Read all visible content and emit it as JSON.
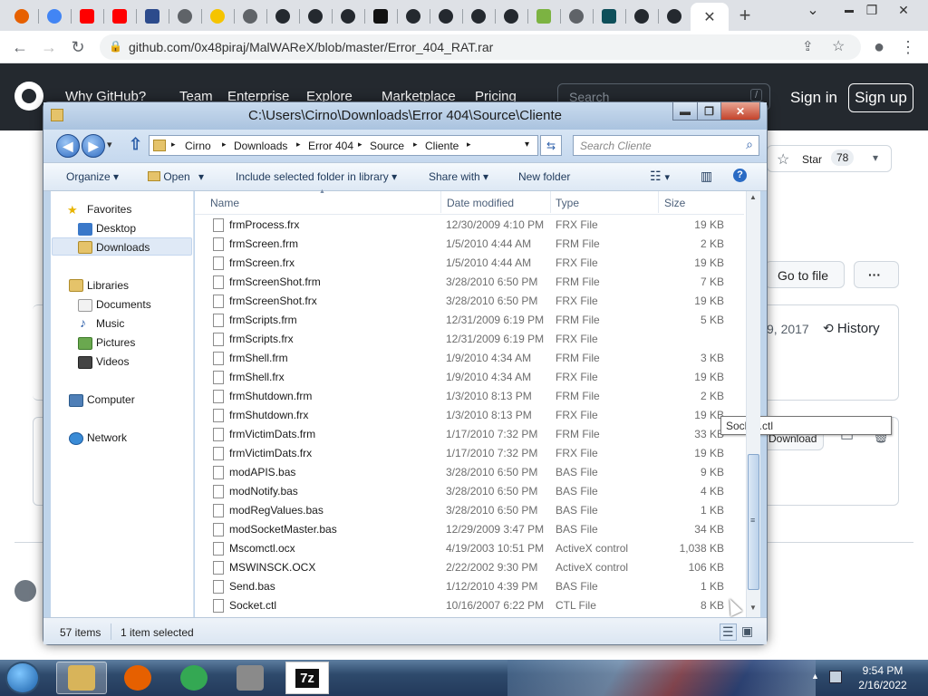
{
  "browser": {
    "url": "github.com/0x48piraj/MalWAReX/blob/master/Error_404_RAT.rar",
    "window_minimize": "▬",
    "window_restore": "❐",
    "window_close": "✕",
    "tab_close": "✕",
    "new_tab": "+",
    "tabs_dropdown": "⌄",
    "back_glyph": "←",
    "forward_glyph": "→",
    "reload_glyph": "↻",
    "lock_glyph": "🔒",
    "share_glyph": "⇪",
    "star_glyph": "☆",
    "profile_glyph": "●",
    "menu_glyph": "⋮",
    "tabs": [
      {
        "icon": "firefox-icon",
        "color": "#e66000"
      },
      {
        "icon": "google-icon",
        "color": "#4285f4"
      },
      {
        "icon": "youtube-icon",
        "color": "#ff0000"
      },
      {
        "icon": "youtube-icon",
        "color": "#ff0000"
      },
      {
        "icon": "site-icon",
        "color": "#2c4b8c"
      },
      {
        "icon": "globe-icon",
        "color": "#5f6368"
      },
      {
        "icon": "shell-icon",
        "color": "#f5c400"
      },
      {
        "icon": "globe-icon",
        "color": "#5f6368"
      },
      {
        "icon": "github-icon",
        "color": "#24292f"
      },
      {
        "icon": "github-icon",
        "color": "#24292f"
      },
      {
        "icon": "github-icon",
        "color": "#24292f"
      },
      {
        "icon": "site-icon",
        "color": "#111111"
      },
      {
        "icon": "github-icon",
        "color": "#24292f"
      },
      {
        "icon": "github-icon",
        "color": "#24292f"
      },
      {
        "icon": "github-icon",
        "color": "#24292f"
      },
      {
        "icon": "github-icon",
        "color": "#24292f"
      },
      {
        "icon": "android-icon",
        "color": "#7cb342"
      },
      {
        "icon": "globe-icon",
        "color": "#5f6368"
      },
      {
        "icon": "site-icon",
        "color": "#0e4f5a"
      },
      {
        "icon": "github-icon",
        "color": "#24292f"
      },
      {
        "icon": "github-icon",
        "color": "#24292f"
      }
    ]
  },
  "github": {
    "nav": [
      "Why GitHub?",
      "Team",
      "Enterprise",
      "Explore",
      "Marketplace",
      "Pricing"
    ],
    "search_placeholder": "Search",
    "search_key": "/",
    "signin": "Sign in",
    "signup": "Sign up",
    "star_label": "Star",
    "star_count": "78",
    "star_dropdown": "▾",
    "goto_file": "Go to file",
    "more": "···",
    "date_fragment": "9, 2017",
    "history": "History",
    "download": "Download"
  },
  "explorer": {
    "title": "C:\\Users\\Cirno\\Downloads\\Error 404\\Source\\Cliente",
    "titlebar_min": "▬",
    "titlebar_max": "❐",
    "titlebar_close": "✕",
    "back_glyph": "◀",
    "forward_glyph": "▶",
    "history_glyph": "▾",
    "up_glyph": "⇧",
    "crumb_sep": "▸",
    "address_dropdown": "▾",
    "refresh_glyph": "⇆",
    "search_glyph": "⌕",
    "breadcrumb": [
      "Cirno",
      "Downloads",
      "Error 404",
      "Source",
      "Cliente"
    ],
    "search_placeholder": "Search Cliente",
    "commands": {
      "organize": "Organize",
      "open": "Open",
      "include": "Include selected folder in library",
      "share": "Share with",
      "new_folder": "New folder"
    },
    "cmd_dropdown": "▾",
    "view_glyph": "☷",
    "preview_glyph": "▥",
    "help_glyph": "?",
    "nav": {
      "favorites": "Favorites",
      "desktop": "Desktop",
      "downloads": "Downloads",
      "libraries": "Libraries",
      "documents": "Documents",
      "music": "Music",
      "pictures": "Pictures",
      "videos": "Videos",
      "computer": "Computer",
      "network": "Network"
    },
    "nav_star_glyph": "★",
    "nav_note_glyph": "♪",
    "columns": {
      "name": "Name",
      "date": "Date modified",
      "type": "Type",
      "size": "Size"
    },
    "sort_glyph": "▲",
    "files": [
      {
        "name": "frmProcess.frx",
        "date": "12/30/2009 4:10 PM",
        "type": "FRX File",
        "size": "19 KB"
      },
      {
        "name": "frmScreen.frm",
        "date": "1/5/2010 4:44 AM",
        "type": "FRM File",
        "size": "2 KB"
      },
      {
        "name": "frmScreen.frx",
        "date": "1/5/2010 4:44 AM",
        "type": "FRX File",
        "size": "19 KB"
      },
      {
        "name": "frmScreenShot.frm",
        "date": "3/28/2010 6:50 PM",
        "type": "FRM File",
        "size": "7 KB"
      },
      {
        "name": "frmScreenShot.frx",
        "date": "3/28/2010 6:50 PM",
        "type": "FRX File",
        "size": "19 KB"
      },
      {
        "name": "frmScripts.frm",
        "date": "12/31/2009 6:19 PM",
        "type": "FRM File",
        "size": "5 KB"
      },
      {
        "name": "frmScripts.frx",
        "date": "12/31/2009 6:19 PM",
        "type": "FRX File",
        "size": ""
      },
      {
        "name": "frmShell.frm",
        "date": "1/9/2010 4:34 AM",
        "type": "FRM File",
        "size": "3 KB"
      },
      {
        "name": "frmShell.frx",
        "date": "1/9/2010 4:34 AM",
        "type": "FRX File",
        "size": "19 KB"
      },
      {
        "name": "frmShutdown.frm",
        "date": "1/3/2010 8:13 PM",
        "type": "FRM File",
        "size": "2 KB"
      },
      {
        "name": "frmShutdown.frx",
        "date": "1/3/2010 8:13 PM",
        "type": "FRX File",
        "size": "19 KB"
      },
      {
        "name": "frmVictimDats.frm",
        "date": "1/17/2010 7:32 PM",
        "type": "FRM File",
        "size": "33 KB"
      },
      {
        "name": "frmVictimDats.frx",
        "date": "1/17/2010 7:32 PM",
        "type": "FRX File",
        "size": "19 KB"
      },
      {
        "name": "modAPIS.bas",
        "date": "3/28/2010 6:50 PM",
        "type": "BAS File",
        "size": "9 KB"
      },
      {
        "name": "modNotify.bas",
        "date": "3/28/2010 6:50 PM",
        "type": "BAS File",
        "size": "4 KB"
      },
      {
        "name": "modRegValues.bas",
        "date": "3/28/2010 6:50 PM",
        "type": "BAS File",
        "size": "1 KB"
      },
      {
        "name": "modSocketMaster.bas",
        "date": "12/29/2009 3:47 PM",
        "type": "BAS File",
        "size": "34 KB"
      },
      {
        "name": "Mscomctl.ocx",
        "date": "4/19/2003 10:51 PM",
        "type": "ActiveX control",
        "size": "1,038 KB"
      },
      {
        "name": "MSWINSCK.OCX",
        "date": "2/22/2002 9:30 PM",
        "type": "ActiveX control",
        "size": "106 KB"
      },
      {
        "name": "Send.bas",
        "date": "1/12/2010 4:39 PM",
        "type": "BAS File",
        "size": "1 KB"
      },
      {
        "name": "Socket.ctl",
        "date": "10/16/2007 6:22 PM",
        "type": "CTL File",
        "size": "8 KB"
      }
    ],
    "tooltip": "Socket.ctl",
    "scroll_up": "▲",
    "scroll_down": "▼",
    "scroll_grip": "≡",
    "status": {
      "items": "57 items",
      "selected": "1 item selected"
    },
    "details_view_glyph": "☰",
    "thumb_view_glyph": "▣"
  },
  "taskbar": {
    "start": "start-orb-icon",
    "apps": [
      {
        "icon": "file-explorer-icon",
        "color": "#d8b45a"
      },
      {
        "icon": "firefox-icon",
        "color": "#e66000"
      },
      {
        "icon": "chrome-icon",
        "color": "#34a853"
      },
      {
        "icon": "tool-icon",
        "color": "#8a8a8a"
      },
      {
        "icon": "7zip-icon",
        "color": "#111111"
      }
    ],
    "sevenzip_label": "7z",
    "tray_flag": "▲",
    "time": "9:54 PM",
    "date": "2/16/2022"
  }
}
